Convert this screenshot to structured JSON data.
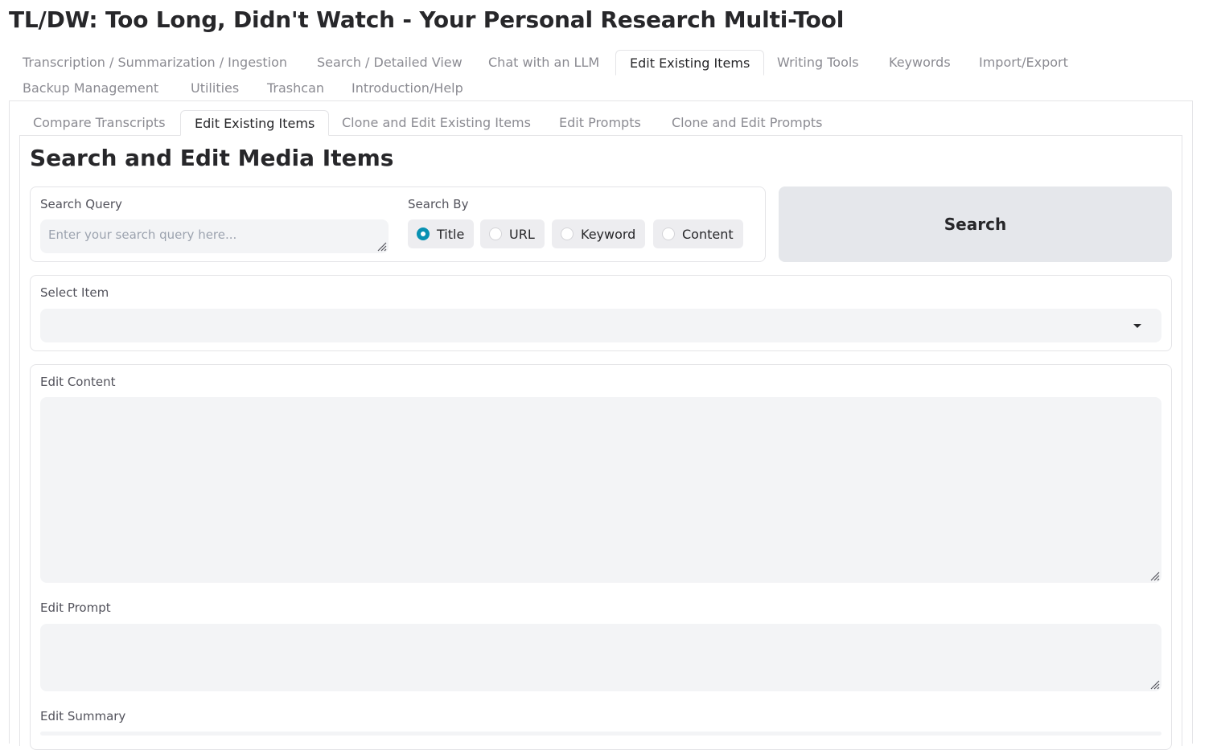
{
  "app": {
    "title": "TL/DW: Too Long, Didn't Watch - Your Personal Research Multi-Tool"
  },
  "main_tabs": [
    {
      "label": "Transcription / Summarization / Ingestion",
      "active": false
    },
    {
      "label": "Search / Detailed View",
      "active": false
    },
    {
      "label": "Chat with an LLM",
      "active": false
    },
    {
      "label": "Edit Existing Items",
      "active": true
    },
    {
      "label": "Writing Tools",
      "active": false
    },
    {
      "label": "Keywords",
      "active": false
    },
    {
      "label": "Import/Export",
      "active": false
    },
    {
      "label": "Backup Management",
      "active": false
    },
    {
      "label": "Utilities",
      "active": false
    },
    {
      "label": "Trashcan",
      "active": false
    },
    {
      "label": "Introduction/Help",
      "active": false
    }
  ],
  "sub_tabs": [
    {
      "label": "Compare Transcripts",
      "active": false
    },
    {
      "label": "Edit Existing Items",
      "active": true
    },
    {
      "label": "Clone and Edit Existing Items",
      "active": false
    },
    {
      "label": "Edit Prompts",
      "active": false
    },
    {
      "label": "Clone and Edit Prompts",
      "active": false
    }
  ],
  "section": {
    "heading": "Search and Edit Media Items"
  },
  "search": {
    "query_label": "Search Query",
    "query_value": "",
    "query_placeholder": "Enter your search query here...",
    "by_label": "Search By",
    "by_options": [
      {
        "label": "Title",
        "checked": true
      },
      {
        "label": "URL",
        "checked": false
      },
      {
        "label": "Keyword",
        "checked": false
      },
      {
        "label": "Content",
        "checked": false
      }
    ],
    "button_label": "Search"
  },
  "select_item": {
    "label": "Select Item",
    "value": ""
  },
  "edit": {
    "content_label": "Edit Content",
    "content_value": "",
    "prompt_label": "Edit Prompt",
    "prompt_value": "",
    "summary_label": "Edit Summary",
    "summary_value": ""
  },
  "colors": {
    "accent": "#0891b2",
    "input_bg": "#f3f4f6",
    "button_bg": "#e5e7eb",
    "border": "#e4e4e7",
    "muted_text": "#8b8b92"
  }
}
